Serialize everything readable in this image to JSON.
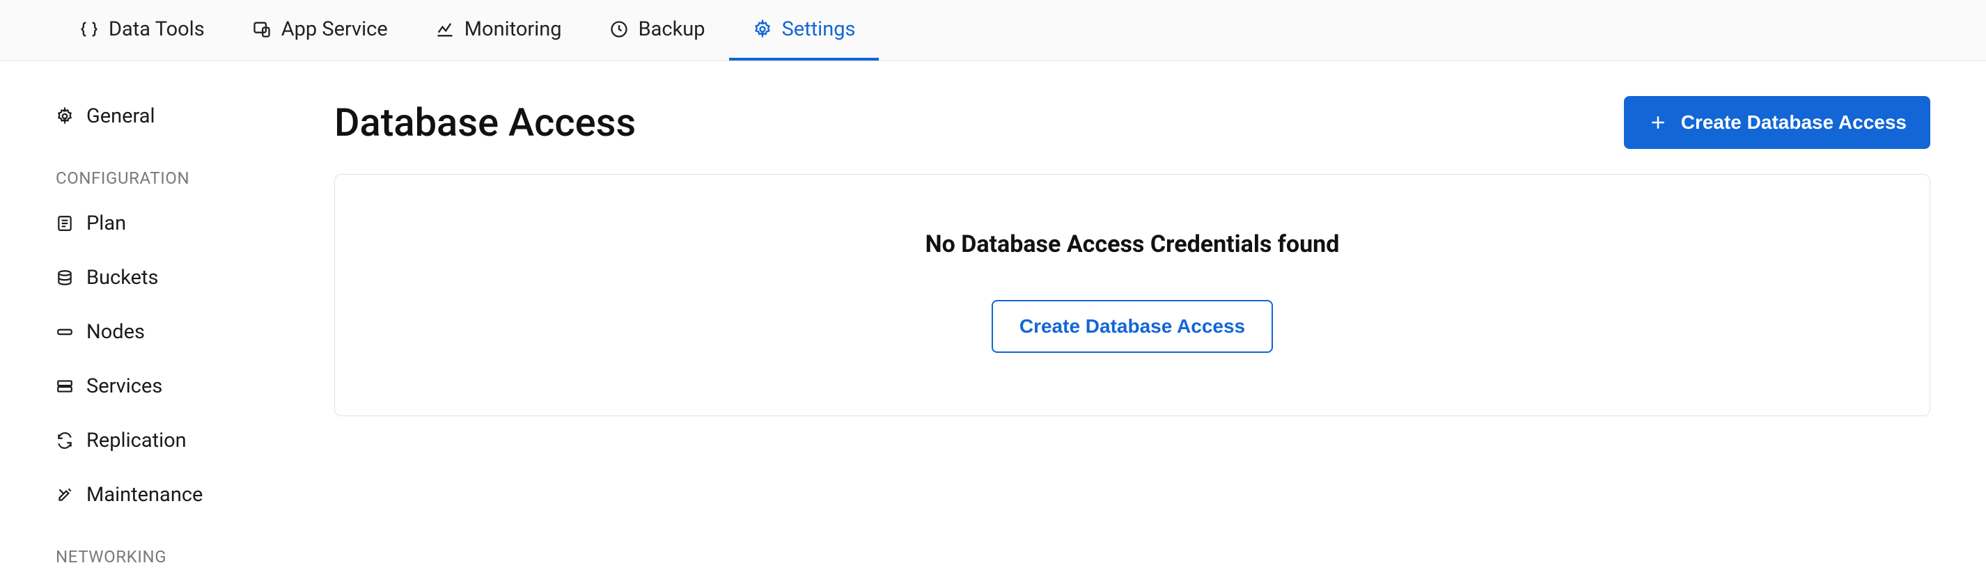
{
  "topnav": {
    "items": [
      {
        "label": "Data Tools",
        "icon": "braces-icon"
      },
      {
        "label": "App Service",
        "icon": "device-icon"
      },
      {
        "label": "Monitoring",
        "icon": "chart-icon"
      },
      {
        "label": "Backup",
        "icon": "clock-icon"
      },
      {
        "label": "Settings",
        "icon": "gear-icon",
        "active": true
      }
    ]
  },
  "sidebar": {
    "top": [
      {
        "label": "General",
        "icon": "gear-icon"
      }
    ],
    "groups": [
      {
        "label": "Configuration",
        "items": [
          {
            "label": "Plan",
            "icon": "plan-icon"
          },
          {
            "label": "Buckets",
            "icon": "database-icon"
          },
          {
            "label": "Nodes",
            "icon": "nodes-icon"
          },
          {
            "label": "Services",
            "icon": "services-icon"
          },
          {
            "label": "Replication",
            "icon": "refresh-icon"
          },
          {
            "label": "Maintenance",
            "icon": "tools-icon"
          }
        ]
      },
      {
        "label": "Networking",
        "items": []
      }
    ]
  },
  "page": {
    "title": "Database Access",
    "primary_button": "Create Database Access",
    "empty_state": {
      "title": "No Database Access Credentials found",
      "button": "Create Database Access"
    }
  }
}
